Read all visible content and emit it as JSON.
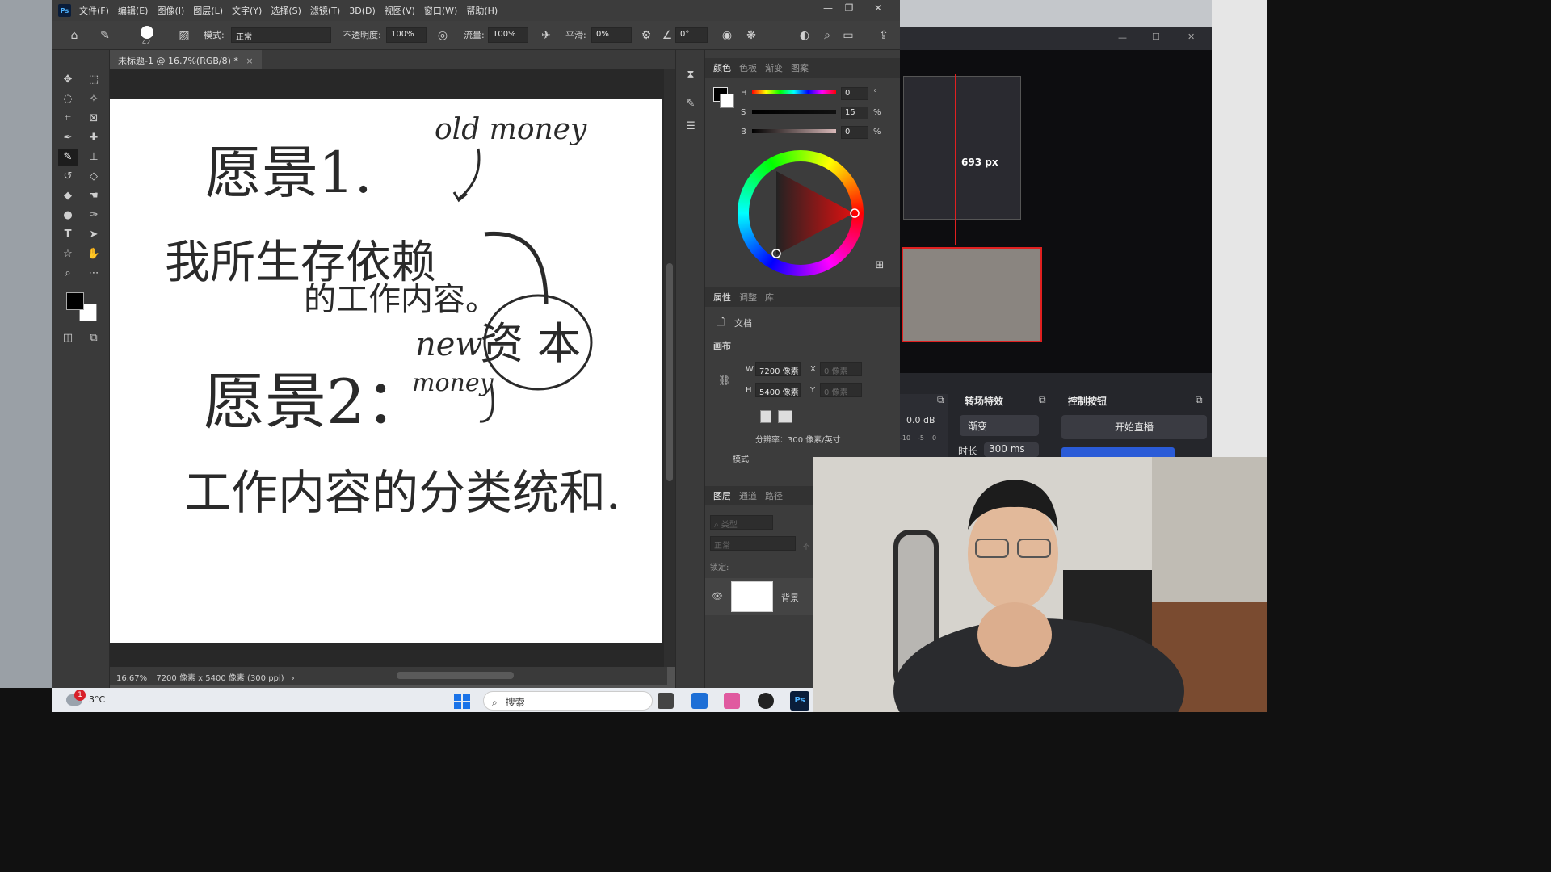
{
  "photoshop": {
    "logo": "Ps",
    "menu": [
      "文件(F)",
      "编辑(E)",
      "图像(I)",
      "图层(L)",
      "文字(Y)",
      "选择(S)",
      "滤镜(T)",
      "3D(D)",
      "视图(V)",
      "窗口(W)",
      "帮助(H)"
    ],
    "options": {
      "brush_size": "42",
      "mode_label": "模式:",
      "mode_value": "正常",
      "opacity_label": "不透明度:",
      "opacity_value": "100%",
      "flow_label": "流量:",
      "flow_value": "100%",
      "smoothing_label": "平滑:",
      "smoothing_value": "0%",
      "angle_value": "0°"
    },
    "document_tab": "未标题-1 @ 16.7%(RGB/8) *",
    "status": {
      "zoom": "16.67%",
      "doc_info": "7200 像素 x 5400 像素 (300 ppi)"
    },
    "canvas_text": {
      "line1": "愿景1.",
      "old_money": "old money",
      "line2a": "我所生存依赖",
      "line2b": "的工作内容。",
      "new_money": "new",
      "capital": "资 本",
      "line3": "愿景2：",
      "money": "money",
      "line4": "工作内容的分类统和."
    },
    "color_panel": {
      "tabs": [
        "颜色",
        "色板",
        "渐变",
        "图案"
      ],
      "h_label": "H",
      "h_value": "0",
      "h_unit": "°",
      "s_label": "S",
      "s_value": "15",
      "s_unit": "%",
      "b_label": "B",
      "b_value": "0",
      "b_unit": "%"
    },
    "properties_panel": {
      "tabs": [
        "属性",
        "调整",
        "库"
      ],
      "doc_label": "文档",
      "canvas_section": "画布",
      "w_label": "W",
      "w_value": "7200 像素",
      "h_label": "H",
      "h_value": "5400 像素",
      "x_label": "X",
      "x_value": "0 像素",
      "y_label": "Y",
      "y_value": "0 像素",
      "resolution": "分辨率：300 像素/英寸",
      "mode_label": "模式"
    },
    "layers_panel": {
      "tabs": [
        "图层",
        "通道",
        "路径"
      ],
      "filter_placeholder": "类型",
      "blend_mode": "正常",
      "blend_extra": "不",
      "lock_label": "锁定:",
      "layer_name": "背景"
    }
  },
  "obs": {
    "preview_size_label": "693 px",
    "audio_db": "0.0 dB",
    "meter_ticks": [
      "-10",
      "-5",
      "0"
    ],
    "transitions_title": "转场特效",
    "transition_value": "渐变",
    "duration_label": "时长",
    "duration_value": "300 ms",
    "controls_title": "控制按钮",
    "start_stream": "开始直播"
  },
  "taskbar": {
    "weather_temp": "3°C",
    "notification_count": "1",
    "search_placeholder": "搜索"
  }
}
